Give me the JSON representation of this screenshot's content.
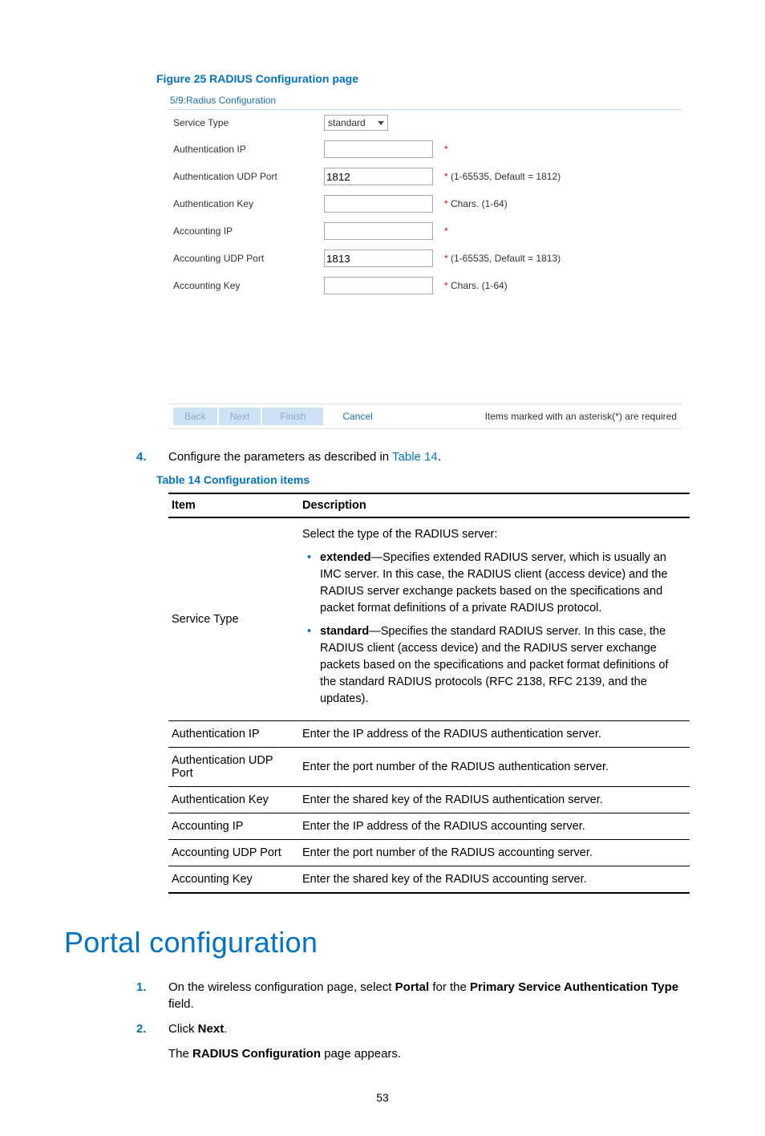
{
  "figure_caption": "Figure 25 RADIUS Configuration page",
  "screenshot": {
    "title": "5/9:Radius Configuration",
    "rows": [
      {
        "label": "Service Type",
        "kind": "select",
        "value": "standard",
        "hint": ""
      },
      {
        "label": "Authentication IP",
        "kind": "input",
        "value": "",
        "hint": "*"
      },
      {
        "label": "Authentication UDP Port",
        "kind": "input",
        "value": "1812",
        "hint": "* (1-65535, Default = 1812)"
      },
      {
        "label": "Authentication Key",
        "kind": "input",
        "value": "",
        "hint": "* Chars. (1-64)"
      },
      {
        "label": "Accounting IP",
        "kind": "input",
        "value": "",
        "hint": "*"
      },
      {
        "label": "Accounting UDP Port",
        "kind": "input",
        "value": "1813",
        "hint": "* (1-65535, Default = 1813)"
      },
      {
        "label": "Accounting Key",
        "kind": "input",
        "value": "",
        "hint": "* Chars. (1-64)"
      }
    ],
    "buttons": {
      "back": "Back",
      "next": "Next",
      "finish": "Finish",
      "cancel": "Cancel"
    },
    "footer_note": "Items marked with an asterisk(*) are required"
  },
  "step4_text_pre": "Configure the parameters as described in ",
  "step4_link": "Table 14",
  "step4_text_post": ".",
  "table_caption": "Table 14 Configuration items",
  "table_headers": {
    "item": "Item",
    "desc": "Description"
  },
  "service_type_desc": {
    "intro": "Select the type of the RADIUS server:",
    "b1_lead": "extended",
    "b1_rest": "—Specifies extended RADIUS server, which is usually an IMC server. In this case, the RADIUS client (access device) and the RADIUS server exchange packets based on the specifications and packet format definitions of a private RADIUS protocol.",
    "b2_lead": "standard",
    "b2_rest": "—Specifies the standard RADIUS server. In this case, the RADIUS client (access device) and the RADIUS server exchange packets based on the specifications and packet format definitions of the standard RADIUS protocols (RFC 2138, RFC 2139, and the updates)."
  },
  "rows": [
    {
      "item": "Service Type",
      "desc": ""
    },
    {
      "item": "Authentication IP",
      "desc": "Enter the IP address of the RADIUS authentication server."
    },
    {
      "item": "Authentication UDP Port",
      "desc": "Enter the port number of the RADIUS authentication server."
    },
    {
      "item": "Authentication Key",
      "desc": "Enter the shared key of the RADIUS authentication server."
    },
    {
      "item": "Accounting IP",
      "desc": "Enter the IP address of the RADIUS accounting server."
    },
    {
      "item": "Accounting UDP Port",
      "desc": "Enter the port number of the RADIUS accounting server."
    },
    {
      "item": "Accounting Key",
      "desc": "Enter the shared key of the RADIUS accounting server."
    }
  ],
  "section_heading": "Portal configuration",
  "portal_step1_pre": "On the wireless configuration page, select ",
  "portal_step1_b1": "Portal",
  "portal_step1_mid": " for the ",
  "portal_step1_b2": "Primary Service Authentication Type",
  "portal_step1_post": " field.",
  "portal_step2_pre": "Click ",
  "portal_step2_b": "Next",
  "portal_step2_post": ".",
  "portal_step2_line2_pre": "The ",
  "portal_step2_line2_b": "RADIUS Configuration",
  "portal_step2_line2_post": " page appears.",
  "page_number": "53",
  "nums": {
    "n4": "4.",
    "n1": "1.",
    "n2": "2."
  }
}
